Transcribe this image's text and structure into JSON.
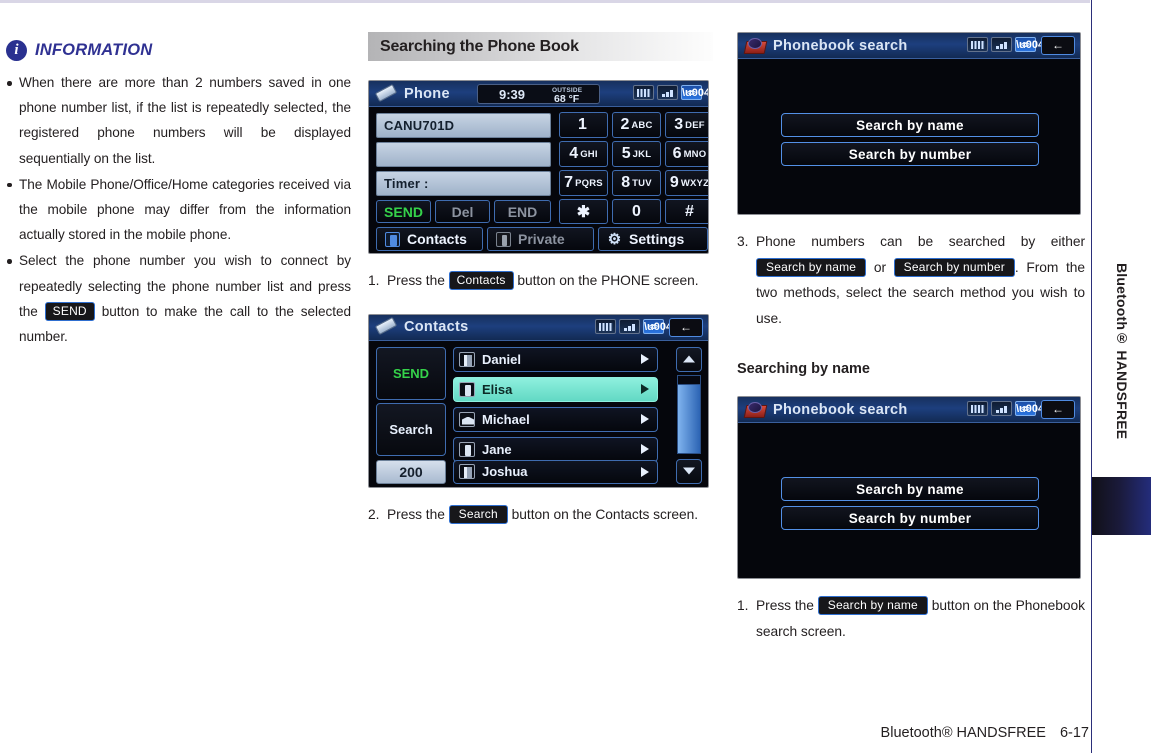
{
  "information": {
    "icon": "info-circle-icon",
    "title": "INFORMATION",
    "bullets": [
      "When there are more than 2 numbers saved in one phone number list, if the list is repeatedly selected, the registered phone numbers will be displayed sequentially on the list.",
      "The Mobile Phone/Office/Home categories received via the mobile phone may differ from the information actually stored in the mobile phone.",
      "Select the phone number you wish to connect by repeatedly selecting the phone number list and press the ",
      " button to make the call to the selected number."
    ],
    "send_key": "SEND"
  },
  "section": {
    "title": "Searching the Phone Book"
  },
  "phone_screen": {
    "icon": "handset-icon",
    "title": "Phone",
    "time": "9:39",
    "outside_label": "OUTSIDE",
    "temp": "68",
    "temp_unit": "°F",
    "status_icons": [
      "battery-icon",
      "signal-icon",
      "bluetooth-icon"
    ],
    "field1": "CANU701D",
    "field2": "",
    "field3": "Timer :",
    "actions": [
      {
        "label": "SEND",
        "style": "green"
      },
      {
        "label": "Del",
        "style": "dim"
      },
      {
        "label": "END",
        "style": "dim"
      }
    ],
    "keypad": [
      {
        "big": "1",
        "sm": ""
      },
      {
        "big": "2",
        "sm": "ABC"
      },
      {
        "big": "3",
        "sm": "DEF"
      },
      {
        "big": "4",
        "sm": "GHI"
      },
      {
        "big": "5",
        "sm": "JKL"
      },
      {
        "big": "6",
        "sm": "MNO"
      },
      {
        "big": "7",
        "sm": "PQRS"
      },
      {
        "big": "8",
        "sm": "TUV"
      },
      {
        "big": "9",
        "sm": "WXYZ"
      },
      {
        "big": "✱",
        "sm": ""
      },
      {
        "big": "0",
        "sm": ""
      },
      {
        "big": "#",
        "sm": ""
      }
    ],
    "bottom": [
      {
        "label": "Contacts",
        "icon": "contacts-icon",
        "style": ""
      },
      {
        "label": "Private",
        "icon": "private-phone-icon",
        "style": "dim"
      },
      {
        "label": "Settings",
        "icon": "gear-icon",
        "style": ""
      }
    ]
  },
  "step1": {
    "num": "1.",
    "pre": "Press the",
    "key": "Contacts",
    "post": "button on the PHONE screen."
  },
  "contacts_screen": {
    "icon": "handset-icon",
    "title": "Contacts",
    "status_icons": [
      "battery-icon",
      "signal-icon",
      "bluetooth-icon"
    ],
    "back": "back-arrow-icon",
    "send_label": "SEND",
    "search_label": "Search",
    "count": "200",
    "rows": [
      {
        "name": "Daniel",
        "icon": "office-icon",
        "selected": false
      },
      {
        "name": "Elisa",
        "icon": "mobile-icon",
        "selected": true
      },
      {
        "name": "Michael",
        "icon": "home-icon",
        "selected": false
      },
      {
        "name": "Jane",
        "icon": "mobile-icon",
        "selected": false
      },
      {
        "name": "Joshua",
        "icon": "office-icon",
        "selected": false
      }
    ],
    "scroll_up": "scroll-up-icon",
    "scroll_down": "scroll-down-icon"
  },
  "step2": {
    "num": "2.",
    "pre": "Press the",
    "key": "Search",
    "post": "button on the Contacts screen."
  },
  "phonebook_screen_1": {
    "icon": "phonebook-icon",
    "title": "Phonebook search",
    "status_icons": [
      "battery-icon",
      "signal-icon",
      "bluetooth-icon"
    ],
    "back": "back-arrow-icon",
    "buttons": [
      "Search by name",
      "Search by number"
    ]
  },
  "step3": {
    "num": "3.",
    "line1": "Phone numbers can be searched by either",
    "key1": "Search by name",
    "mid": "or",
    "key2": "Search by number",
    "dot": ".",
    "line2": "From the two methods, select the search method you wish to use."
  },
  "subsection": {
    "title": "Searching by name"
  },
  "phonebook_screen_2": {
    "icon": "phonebook-icon",
    "title": "Phonebook search",
    "status_icons": [
      "battery-icon",
      "signal-icon",
      "bluetooth-icon"
    ],
    "back": "back-arrow-icon",
    "buttons": [
      "Search by name",
      "Search by number"
    ]
  },
  "step4": {
    "num": "1.",
    "pre": "Press the",
    "key": "Search by name",
    "post": "button on the Phonebook search screen."
  },
  "sidebar": {
    "tab_label": "Bluetooth® HANDSFREE"
  },
  "footer": {
    "text": "Bluetooth® HANDSFREE",
    "page": "6-17"
  }
}
